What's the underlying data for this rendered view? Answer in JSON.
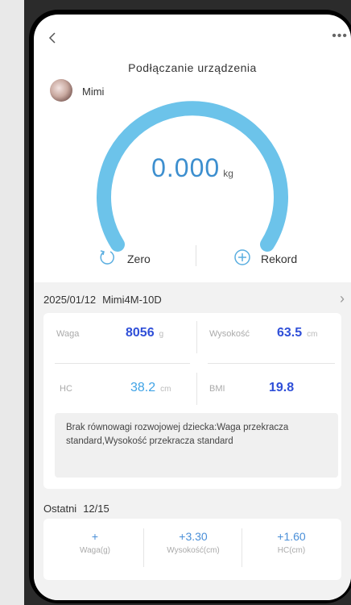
{
  "header": {
    "back_icon": "chevron-left-icon",
    "more_icon": "more-icon",
    "status": "Podłączanie urządzenia"
  },
  "user": {
    "name": "Mimi"
  },
  "scale": {
    "value": "0.000",
    "unit": "kg"
  },
  "actions": {
    "zero_label": "Zero",
    "record_label": "Rekord"
  },
  "record": {
    "date": "2025/01/12",
    "name": "Mimi4M-10D",
    "metrics": {
      "weight": {
        "label": "Waga",
        "value": "8056",
        "unit": "g"
      },
      "height": {
        "label": "Wysokość",
        "value": "63.5",
        "unit": "cm"
      },
      "hc": {
        "label": "HC",
        "value": "38.2",
        "unit": "cm"
      },
      "bmi": {
        "label": "BMI",
        "value": "19.8",
        "unit": ""
      }
    },
    "warning": "Brak równowagi rozwojowej dziecka:Waga przekracza standard,Wysokość przekracza standard"
  },
  "recent": {
    "title": "Ostatni",
    "date": "12/15",
    "items": [
      {
        "value": "+",
        "label": "Waga(g)"
      },
      {
        "value": "+3.30",
        "label": "Wysokość(cm)"
      },
      {
        "value": "+1.60",
        "label": "HC(cm)"
      }
    ]
  },
  "colors": {
    "gauge": "#6cc3ea",
    "weight_value": "#2f4fd8",
    "hc_value": "#3fa3e6",
    "accent": "#3d8fcf"
  }
}
